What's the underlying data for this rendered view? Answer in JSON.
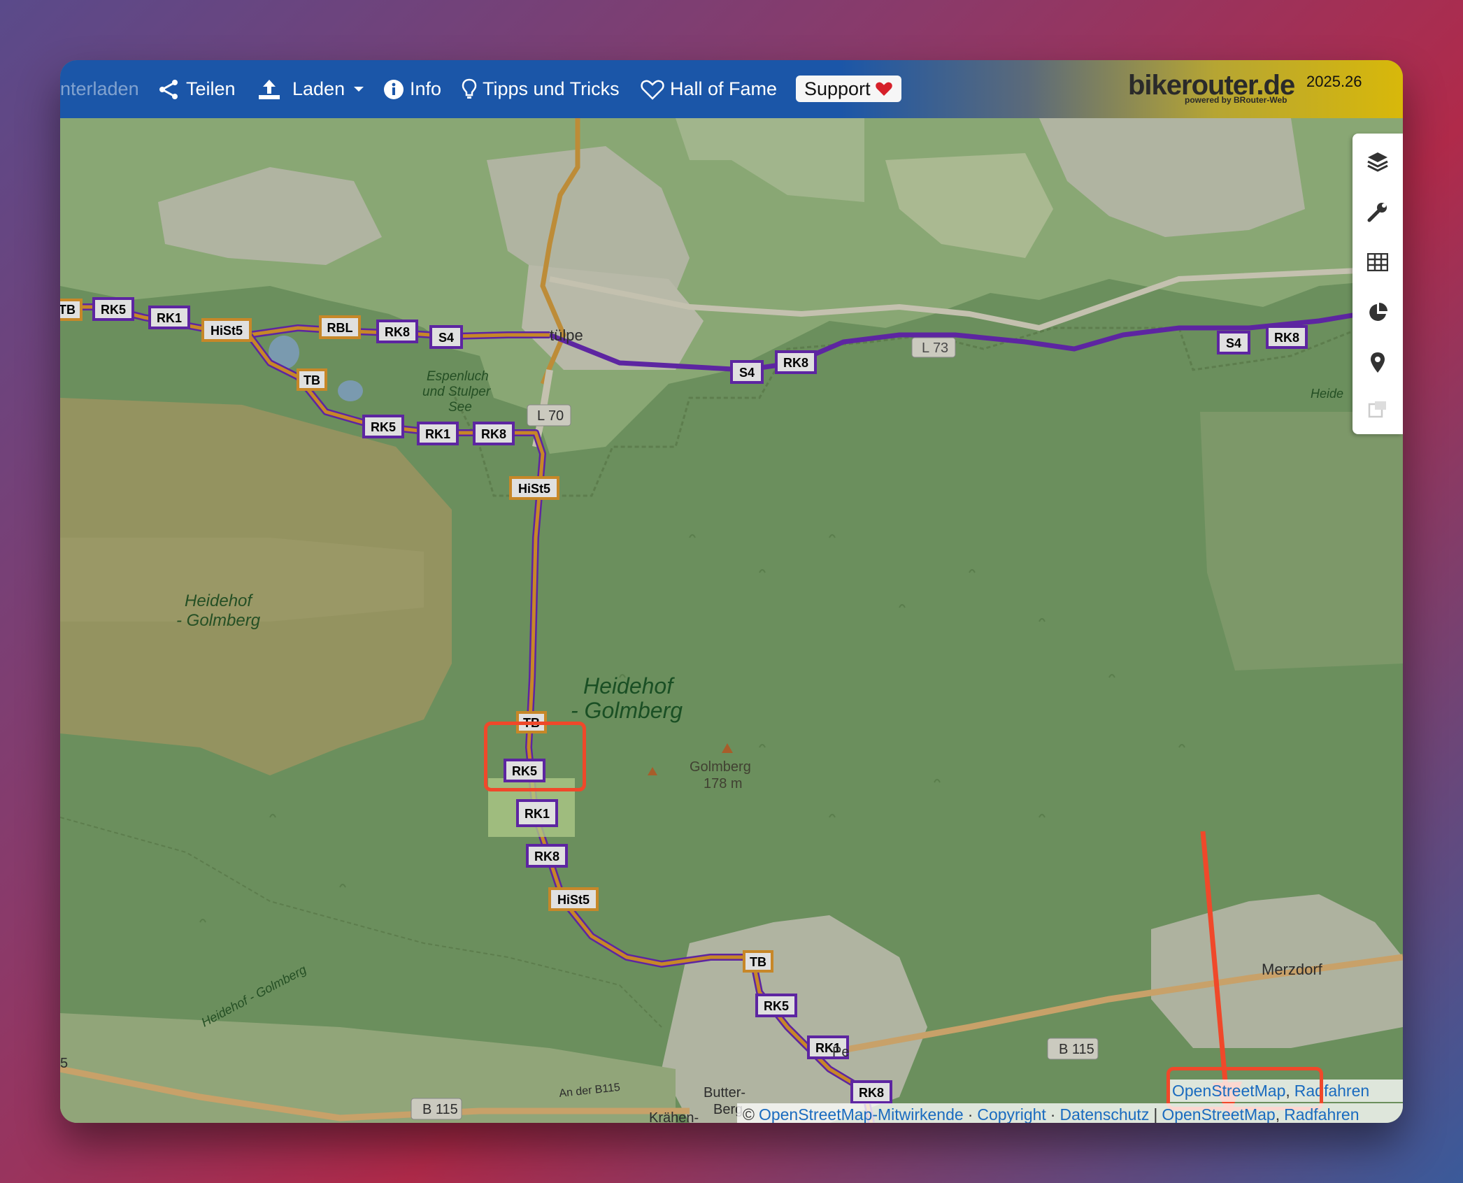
{
  "nav": {
    "download_label": "nterladen",
    "share_label": "Teilen",
    "load_label": "Laden",
    "info_label": "Info",
    "tips_label": "Tipps und Tricks",
    "hall_label": "Hall of Fame",
    "support_label": "Support"
  },
  "brand": {
    "name": "bikerouter.de",
    "sub": "powered by BRouter-Web",
    "version": "2025.26"
  },
  "sidebar": {
    "buttons": [
      "layers-icon",
      "wrench-icon",
      "table-icon",
      "pie-chart-icon",
      "map-pin-icon",
      "export-icon"
    ]
  },
  "map": {
    "labels": {
      "stulpe": "tülpe",
      "espenluch": "Espenluch",
      "und_stulper": "und Stulper",
      "see": "See",
      "l70": "L 70",
      "l73": "L 73",
      "heidehof_left_1": "Heidehof",
      "heidehof_left_2": "- Golmberg",
      "heidehof_big_1": "Heidehof",
      "heidehof_big_2": "- Golmberg",
      "golmberg": "Golmberg",
      "golmberg_height": "178 m",
      "merzdorf": "Merzdorf",
      "b115_a": "B 115",
      "b115_b": "B 115",
      "an_der_b115": "An der B115",
      "road_diag": "Heidehof - Golmberg",
      "heide_right": "Heide",
      "butter": "Butter-",
      "berg": "Berg",
      "kraehen": "Krähen-",
      "pe": "Pe",
      "edge5": "5"
    },
    "route_badges": [
      "TB",
      "RK5",
      "RK1",
      "HiSt5",
      "RBL",
      "RK8",
      "S4",
      "TB",
      "RK5",
      "RK1",
      "RK8",
      "HiSt5",
      "S4",
      "RK8",
      "S4",
      "RK8",
      "TB",
      "RK5",
      "RK1",
      "RK8",
      "HiSt5",
      "TB",
      "RK5",
      "RK1",
      "RK8"
    ]
  },
  "attribution": {
    "top_osm": "OpenStreetMap",
    "top_sep": ",",
    "top_radfahren": "Radfahren",
    "copy_symbol": "©",
    "contributors": "OpenStreetMap-Mitwirkende",
    "dot1": "·",
    "copyright": "Copyright",
    "dot2": "·",
    "privacy": "Datenschutz",
    "bar": "|",
    "osm": "OpenStreetMap",
    "comma": ",",
    "radfahren": "Radfahren"
  },
  "colors": {
    "route": "#e39a2e",
    "route_alt": "#6a2bb8",
    "highlight": "#f0482a",
    "nav_bg": "#1b56a8",
    "forest": "#7aa36a"
  }
}
